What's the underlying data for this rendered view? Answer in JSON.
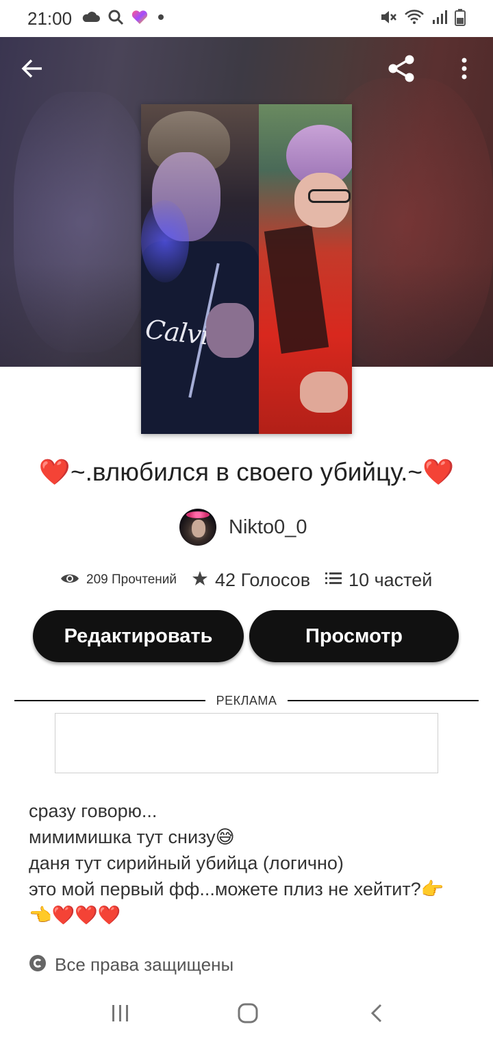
{
  "status_bar": {
    "time": "21:00",
    "icons": [
      "cloud-icon",
      "search-icon",
      "heart-app-icon",
      "dot-icon",
      "mute-icon",
      "wifi-icon",
      "signal-icon",
      "battery-icon"
    ]
  },
  "header": {
    "back_icon": "arrow-left-icon",
    "share_icon": "share-icon",
    "more_icon": "more-vertical-icon"
  },
  "cover_text": "Calvin",
  "story": {
    "title": "❤️~.влюбился в своего убийцу.~❤️",
    "author": "Nikto0_0",
    "reads": "209 Прочтений",
    "votes": "42 Голосов",
    "parts": "10 частей"
  },
  "buttons": {
    "edit": "Редактировать",
    "view": "Просмотр"
  },
  "ad": {
    "label": "РЕКЛАМА"
  },
  "description": {
    "lines": [
      "сразу говорю...",
      "мимимишка тут снизу😅",
      "даня тут сирийный убийца (логично)",
      "это мой первый фф...можете плиз не хейтит?👉",
      "👈❤️❤️❤️"
    ]
  },
  "copyright": "Все права защищены",
  "colors": {
    "button_bg": "#111111",
    "button_text": "#ffffff",
    "text": "#333333"
  }
}
